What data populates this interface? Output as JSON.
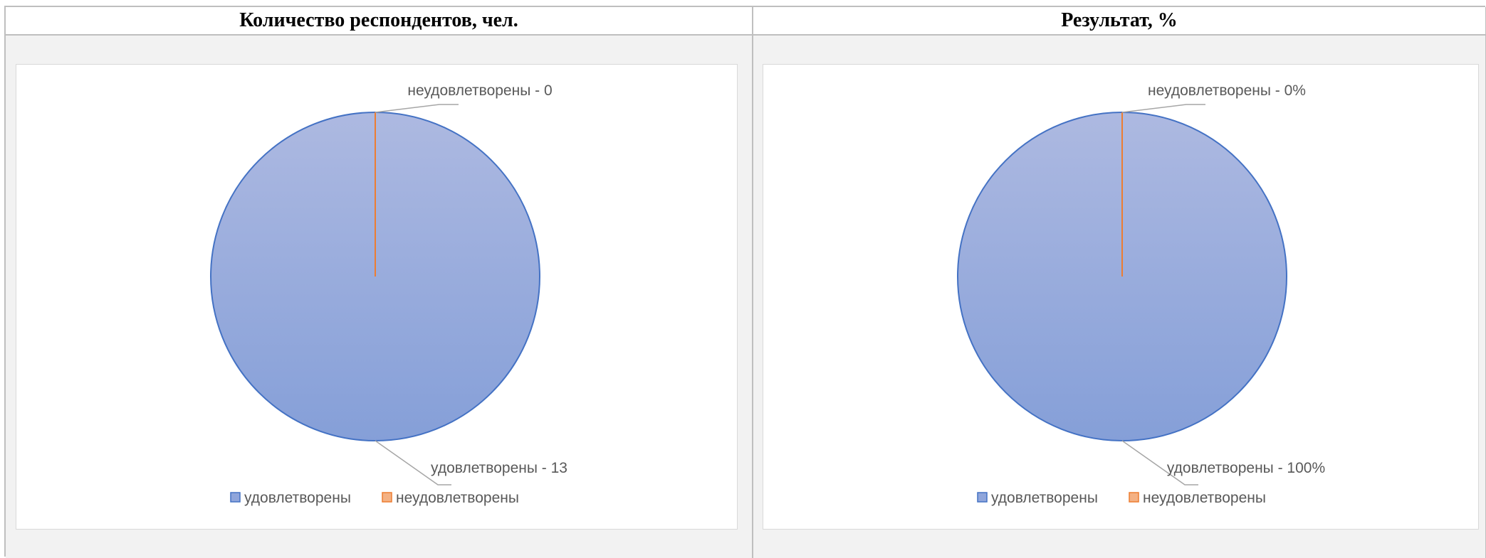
{
  "chart_data": [
    {
      "type": "pie",
      "title": "Количество респондентов, чел.",
      "categories": [
        "удовлетворены",
        "неудовлетворены"
      ],
      "values": [
        13,
        0
      ],
      "data_labels": [
        "удовлетворены - 13",
        "неудовлетворены - 0"
      ],
      "colors": [
        "#8fa5db",
        "#ed7d31"
      ],
      "legend_position": "bottom"
    },
    {
      "type": "pie",
      "title": "Результат, %",
      "categories": [
        "удовлетворены",
        "неудовлетворены"
      ],
      "values": [
        100,
        0
      ],
      "data_labels": [
        "удовлетворены - 100%",
        "неудовлетворены - 0%"
      ],
      "colors": [
        "#8fa5db",
        "#ed7d31"
      ],
      "legend_position": "bottom"
    }
  ]
}
